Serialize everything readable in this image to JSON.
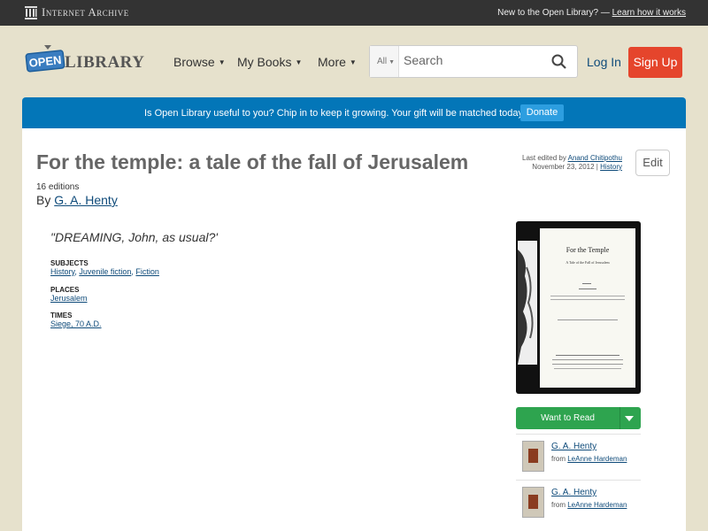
{
  "ia_bar": {
    "logo_text": "Internet Archive",
    "new_text": "New to the Open Library? —",
    "learn_link": "Learn how it works"
  },
  "header": {
    "logo_open": "OPEN",
    "logo_library": "LIBRARY",
    "nav": [
      {
        "label": "Browse"
      },
      {
        "label": "My Books"
      },
      {
        "label": "More"
      }
    ],
    "search": {
      "scope": "All",
      "placeholder": "Search"
    },
    "login": "Log In",
    "signup": "Sign Up"
  },
  "donate_banner": {
    "message": "Is Open Library useful to you? Chip in to keep it growing. Your gift will be matched today!",
    "button": "Donate"
  },
  "work": {
    "title": "For the temple: a tale of the fall of Jerusalem",
    "editions": "16 editions",
    "by_prefix": "By",
    "author": "G. A. Henty",
    "first_sentence": "\"DREAMING, John, as usual?'",
    "last_edited_prefix": "Last edited by",
    "last_edited_by": "Anand Chitipothu",
    "last_edited_date": "November 23, 2012 |",
    "history_link": "History",
    "edit_button": "Edit",
    "subjects_label": "Subjects",
    "subjects": [
      "History",
      "Juvenile fiction",
      "Fiction"
    ],
    "places_label": "Places",
    "places": [
      "Jerusalem"
    ],
    "times_label": "Times",
    "times": [
      "Siege, 70 A.D."
    ]
  },
  "cover": {
    "title": "For the Temple",
    "subtitle": "A Tale of the Fall of Jerusalem"
  },
  "sidebar": {
    "want_to_read": "Want to Read",
    "lists": [
      {
        "author": "G. A. Henty",
        "from_prefix": "from",
        "from_user": "LeAnne Hardeman"
      },
      {
        "author": "G. A. Henty",
        "from_prefix": "from",
        "from_user": "LeAnne Hardeman"
      }
    ]
  }
}
